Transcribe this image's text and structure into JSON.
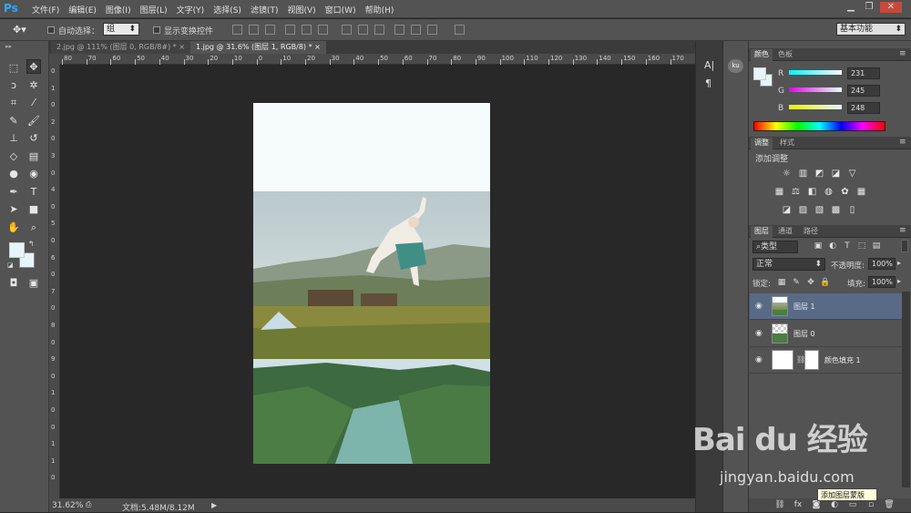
{
  "app": {
    "logo": "Ps"
  },
  "menu": [
    "文件(F)",
    "编辑(E)",
    "图像(I)",
    "图层(L)",
    "文字(Y)",
    "选择(S)",
    "滤镜(T)",
    "视图(V)",
    "窗口(W)",
    "帮助(H)"
  ],
  "window_controls": [
    "minimize-icon",
    "restore-icon",
    "close-icon"
  ],
  "options": {
    "auto_select_label": "自动选择：",
    "auto_select_value": "组",
    "show_transform_label": "显示变换控件",
    "workspace": "基本功能"
  },
  "tabs": [
    {
      "label": "2.jpg @ 111% (图层 0, RGB/8#) *",
      "active": false
    },
    {
      "label": "1.jpg @ 31.6% (图层 1, RGB/8) *",
      "active": true
    }
  ],
  "ruler_h": [
    "80",
    "70",
    "60",
    "50",
    "40",
    "30",
    "20",
    "10",
    "0",
    "10",
    "20",
    "30",
    "40",
    "50",
    "60",
    "70",
    "80",
    "90",
    "100",
    "110",
    "120",
    "130",
    "140",
    "150",
    "160",
    "170"
  ],
  "ruler_v": [
    "0",
    "1",
    "0",
    "2",
    "0",
    "3",
    "0",
    "4",
    "0",
    "5",
    "0",
    "6",
    "0",
    "7",
    "0",
    "8",
    "0",
    "9",
    "0",
    "1",
    "0",
    "0",
    "1",
    "1",
    "0"
  ],
  "status": {
    "zoom": "31.62%",
    "doc": "文档:5.48M/8.12M"
  },
  "color_panel": {
    "tabs": [
      "颜色",
      "色板"
    ],
    "channels": [
      {
        "name": "R",
        "value": "231"
      },
      {
        "name": "G",
        "value": "245"
      },
      {
        "name": "B",
        "value": "248"
      }
    ],
    "fg_color": "#e7f5f8"
  },
  "adjust_panel": {
    "tabs": [
      "调整",
      "样式"
    ],
    "title": "添加调整"
  },
  "layers_panel": {
    "tabs": [
      "图层",
      "通道",
      "路径"
    ],
    "filter": "类型",
    "blend": "正常",
    "opacity_label": "不透明度:",
    "opacity": "100%",
    "lock_label": "锁定:",
    "fill_label": "填充:",
    "fill": "100%",
    "layers": [
      {
        "name": "图层 1",
        "selected": true
      },
      {
        "name": "图层 0",
        "selected": false
      },
      {
        "name": "颜色填充 1",
        "selected": false
      }
    ]
  },
  "tooltip": "添加图层蒙版",
  "watermark": {
    "brand": "Bai du 经验",
    "url": "jingyan.baidu.com"
  },
  "colors": {
    "accent": "#31a8ff",
    "panel": "#535353",
    "canvas": "#282828",
    "selected_layer": "#596a87"
  }
}
